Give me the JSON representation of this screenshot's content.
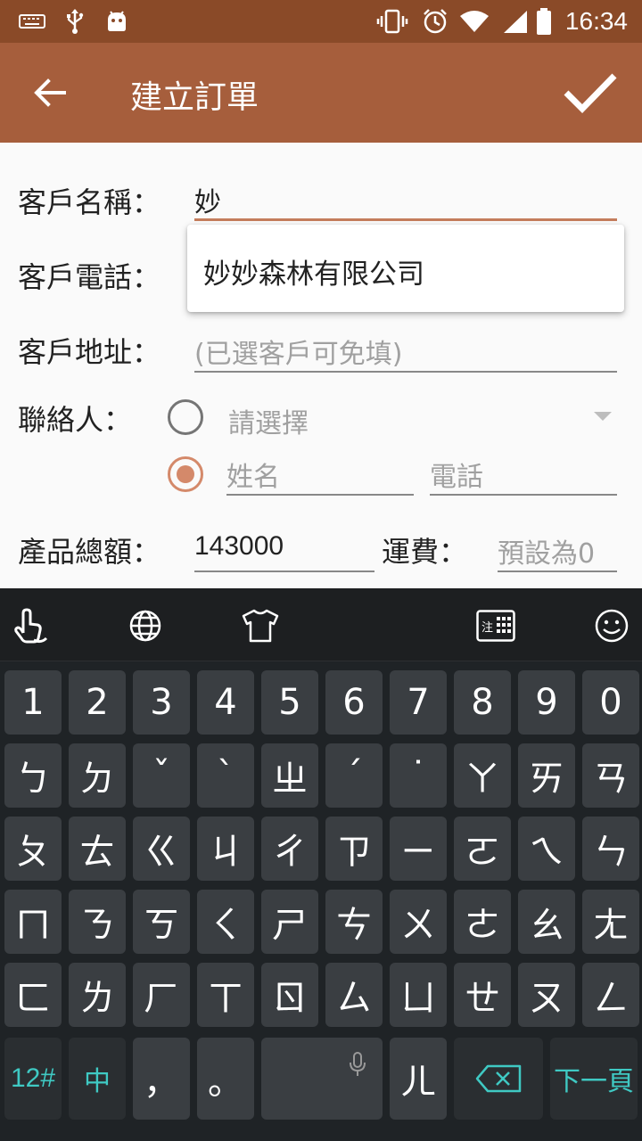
{
  "status_bar": {
    "time": "16:34"
  },
  "app_bar": {
    "title": "建立訂單"
  },
  "form": {
    "customer_name_label": "客戶名稱：",
    "customer_name_value": "妙",
    "suggestion": "妙妙森林有限公司",
    "customer_phone_label": "客戶電話：",
    "customer_address_label": "客戶地址：",
    "customer_address_placeholder": "(已選客戶可免填)",
    "contact_label": "聯絡人：",
    "contact_select_placeholder": "請選擇",
    "contact_name_placeholder": "姓名",
    "contact_phone_placeholder": "電話",
    "product_total_label": "產品總額：",
    "product_total_value": "143000",
    "shipping_label": "運費：",
    "shipping_placeholder": "預設為0"
  },
  "keyboard": {
    "toolbar_icons": [
      "touchpal-logo-icon",
      "globe-icon",
      "tshirt-icon",
      "zhuyin-layout-icon",
      "emoji-icon"
    ],
    "rows": [
      [
        "1",
        "2",
        "3",
        "4",
        "5",
        "6",
        "7",
        "8",
        "9",
        "0"
      ],
      [
        "ㄅ",
        "ㄉ",
        "ˇ",
        "ˋ",
        "ㄓ",
        "ˊ",
        "˙",
        "ㄚ",
        "ㄞ",
        "ㄢ"
      ],
      [
        "ㄆ",
        "ㄊ",
        "ㄍ",
        "ㄐ",
        "ㄔ",
        "ㄗ",
        "ㄧ",
        "ㄛ",
        "ㄟ",
        "ㄣ"
      ],
      [
        "ㄇ",
        "ㄋ",
        "ㄎ",
        "ㄑ",
        "ㄕ",
        "ㄘ",
        "ㄨ",
        "ㄜ",
        "ㄠ",
        "ㄤ"
      ],
      [
        "ㄈ",
        "ㄌ",
        "ㄏ",
        "ㄒ",
        "ㄖ",
        "ㄙ",
        "ㄩ",
        "ㄝ",
        "ㄡ",
        "ㄥ"
      ]
    ],
    "bottom": {
      "numsym": "12#",
      "lang": "中",
      "comma": "，",
      "period": "。",
      "er": "ㄦ",
      "next_page": "下一頁"
    },
    "accent_color": "#3fc9c3"
  },
  "colors": {
    "status_bar": "#8a4a28",
    "app_bar": "#a65e3c",
    "radio_accent": "#d4896a"
  }
}
